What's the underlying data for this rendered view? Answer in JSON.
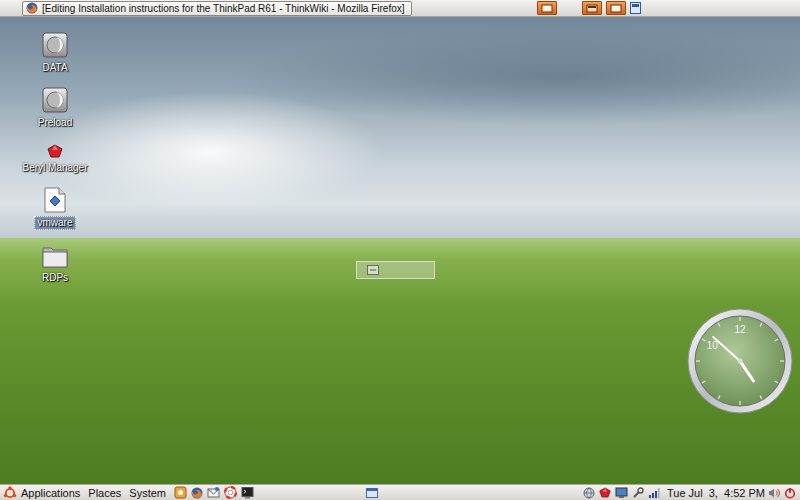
{
  "top_panel": {
    "window_button": {
      "title": "[Editing Installation instructions for the ThinkPad R61 - ThinkWiki - Mozilla Firefox]"
    }
  },
  "desktop_icons": [
    {
      "label": "DATA",
      "kind": "drive",
      "selected": false
    },
    {
      "label": "Preload",
      "kind": "drive",
      "selected": false
    },
    {
      "label": "Beryl Manager",
      "kind": "beryl",
      "selected": false
    },
    {
      "label": "vmware",
      "kind": "file",
      "selected": true
    },
    {
      "label": "RDPs",
      "kind": "folder",
      "selected": false
    }
  ],
  "clock_widget": {
    "hour": 4,
    "minute": 52,
    "numbers": [
      {
        "text": "12",
        "hour": 12
      },
      {
        "text": "10",
        "hour": 10
      }
    ]
  },
  "bottom_panel": {
    "menus": [
      "Applications",
      "Places",
      "System"
    ],
    "clock": "Tue Jul  3,  4:52 PM"
  }
}
